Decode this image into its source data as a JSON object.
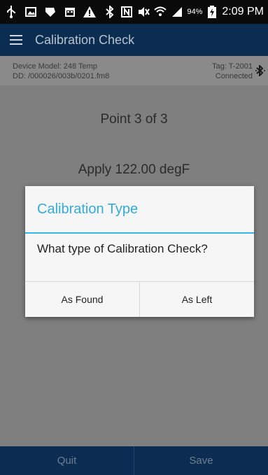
{
  "status_bar": {
    "battery_percent": "94%",
    "time": "2:09 PM",
    "icons": [
      "usb-icon",
      "image-icon",
      "app-icon",
      "calendar-icon",
      "warning-icon",
      "bluetooth-icon",
      "nfc-icon",
      "mute-icon",
      "wifi-icon",
      "signal-icon",
      "battery-charging-icon"
    ]
  },
  "app_bar": {
    "title": "Calibration Check"
  },
  "device_info": {
    "model_line": "Device Model: 248 Temp",
    "dd_line": "DD: /000026/003b/0201.fm8",
    "tag_line": "Tag: T-2001",
    "status_line": "Connected"
  },
  "main": {
    "point_text": "Point 3 of 3",
    "apply_text": "Apply 122.00 degF"
  },
  "dialog": {
    "title": "Calibration Type",
    "message": "What type of Calibration Check?",
    "button_as_found": "As Found",
    "button_as_left": "As Left"
  },
  "bottom_bar": {
    "quit_label": "Quit",
    "save_label": "Save"
  },
  "colors": {
    "app_bar": "#0b2d52",
    "dialog_accent": "#33b5e5",
    "dim_background": "#7f7f7f"
  }
}
